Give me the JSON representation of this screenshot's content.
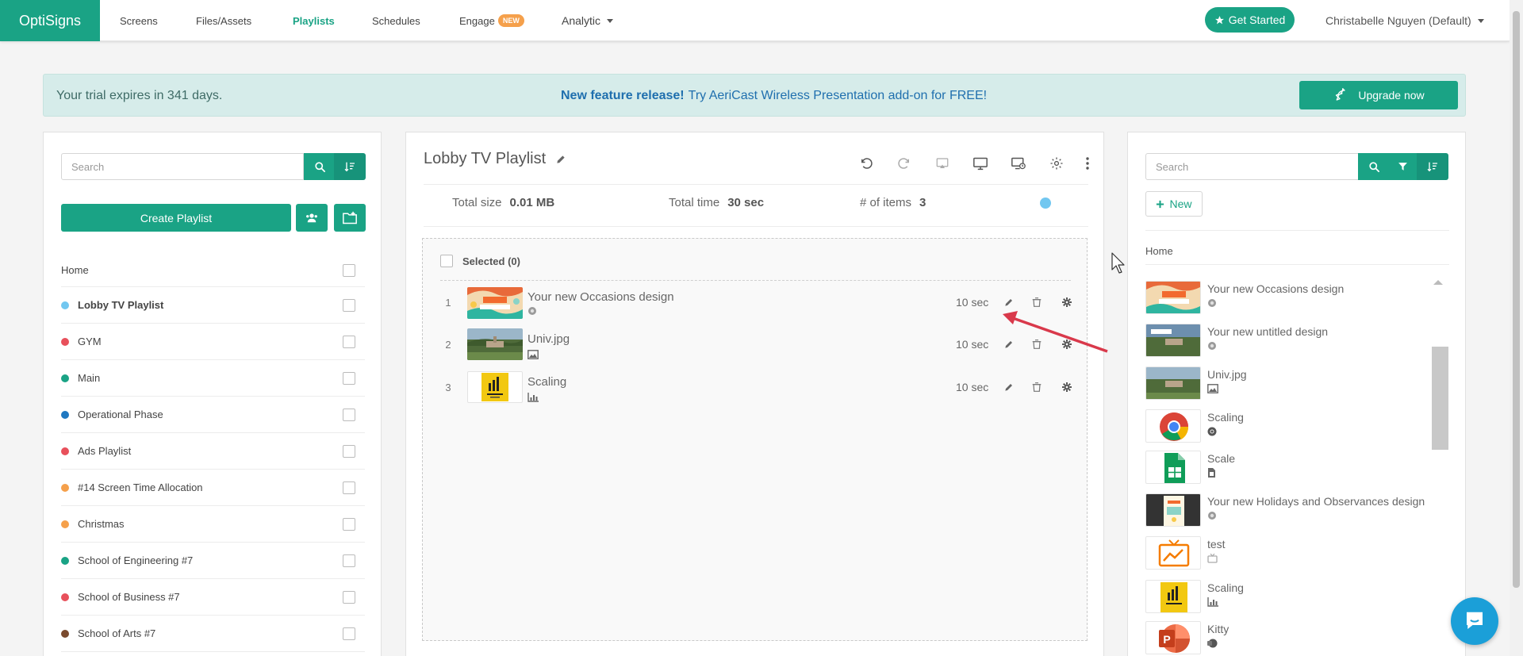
{
  "nav": {
    "brand": "OptiSigns",
    "items": [
      "Screens",
      "Files/Assets",
      "Playlists",
      "Schedules",
      "Engage",
      "Analytic"
    ],
    "engage_badge": "NEW",
    "get_started": "Get Started",
    "user": "Christabelle Nguyen (Default)"
  },
  "banner": {
    "trial": "Your trial expires in 341 days.",
    "feature_bold": "New feature release!",
    "feature_text": "Try AeriCast Wireless Presentation add-on for FREE!",
    "upgrade": "Upgrade now"
  },
  "left": {
    "search_placeholder": "Search",
    "create_button": "Create Playlist",
    "home": "Home",
    "playlists": [
      {
        "name": "Lobby TV Playlist",
        "color": "#72c7f0",
        "selected": true
      },
      {
        "name": "GYM",
        "color": "#e8505b"
      },
      {
        "name": "Main",
        "color": "#1aa385"
      },
      {
        "name": "Operational Phase",
        "color": "#1f78c1"
      },
      {
        "name": "Ads Playlist",
        "color": "#e8505b"
      },
      {
        "name": "#14 Screen Time Allocation",
        "color": "#f5a04b"
      },
      {
        "name": "Christmas",
        "color": "#f5a04b"
      },
      {
        "name": "School of Engineering #7",
        "color": "#1aa385"
      },
      {
        "name": "School of Business #7",
        "color": "#e8505b"
      },
      {
        "name": "School of Arts #7",
        "color": "#7a4a2e"
      }
    ]
  },
  "middle": {
    "title": "Lobby TV Playlist",
    "toolbar_icons": [
      "undo-icon",
      "redo-icon",
      "cast-icon",
      "monitor-icon",
      "schedule-screen-icon",
      "settings-icon",
      "more-icon"
    ],
    "total_size_label": "Total size",
    "total_size": "0.01 MB",
    "total_time_label": "Total time",
    "total_time": "30 sec",
    "items_label": "# of items",
    "items_count": "3",
    "selected_label": "Selected (0)",
    "items": [
      {
        "num": "1",
        "name": "Your new Occasions design",
        "duration": "10 sec",
        "type_icon": "design-icon"
      },
      {
        "num": "2",
        "name": "Univ.jpg",
        "duration": "10 sec",
        "type_icon": "image-icon"
      },
      {
        "num": "3",
        "name": "Scaling",
        "duration": "10 sec",
        "type_icon": "chart-icon"
      }
    ]
  },
  "right": {
    "search_placeholder": "Search",
    "new_button": "New",
    "home": "Home",
    "assets": [
      {
        "name": "Your new Occasions design",
        "type_icon": "design-icon"
      },
      {
        "name": "Your new untitled design",
        "type_icon": "design-icon"
      },
      {
        "name": "Univ.jpg",
        "type_icon": "image-icon"
      },
      {
        "name": "Scaling",
        "type_icon": "chrome-icon"
      },
      {
        "name": "Scale",
        "type_icon": "sheet-icon"
      },
      {
        "name": "Your new Holidays and Observances design",
        "type_icon": "design-icon"
      },
      {
        "name": "test",
        "type_icon": "app-icon"
      },
      {
        "name": "Scaling",
        "type_icon": "chart-icon"
      },
      {
        "name": "Kitty",
        "type_icon": "slides-icon"
      }
    ]
  },
  "colors": {
    "accent": "#1aa385",
    "link": "#1f6fae",
    "banner_bg": "#d6ecea",
    "chat": "#1b9fd8",
    "arrow": "#d9394b"
  }
}
